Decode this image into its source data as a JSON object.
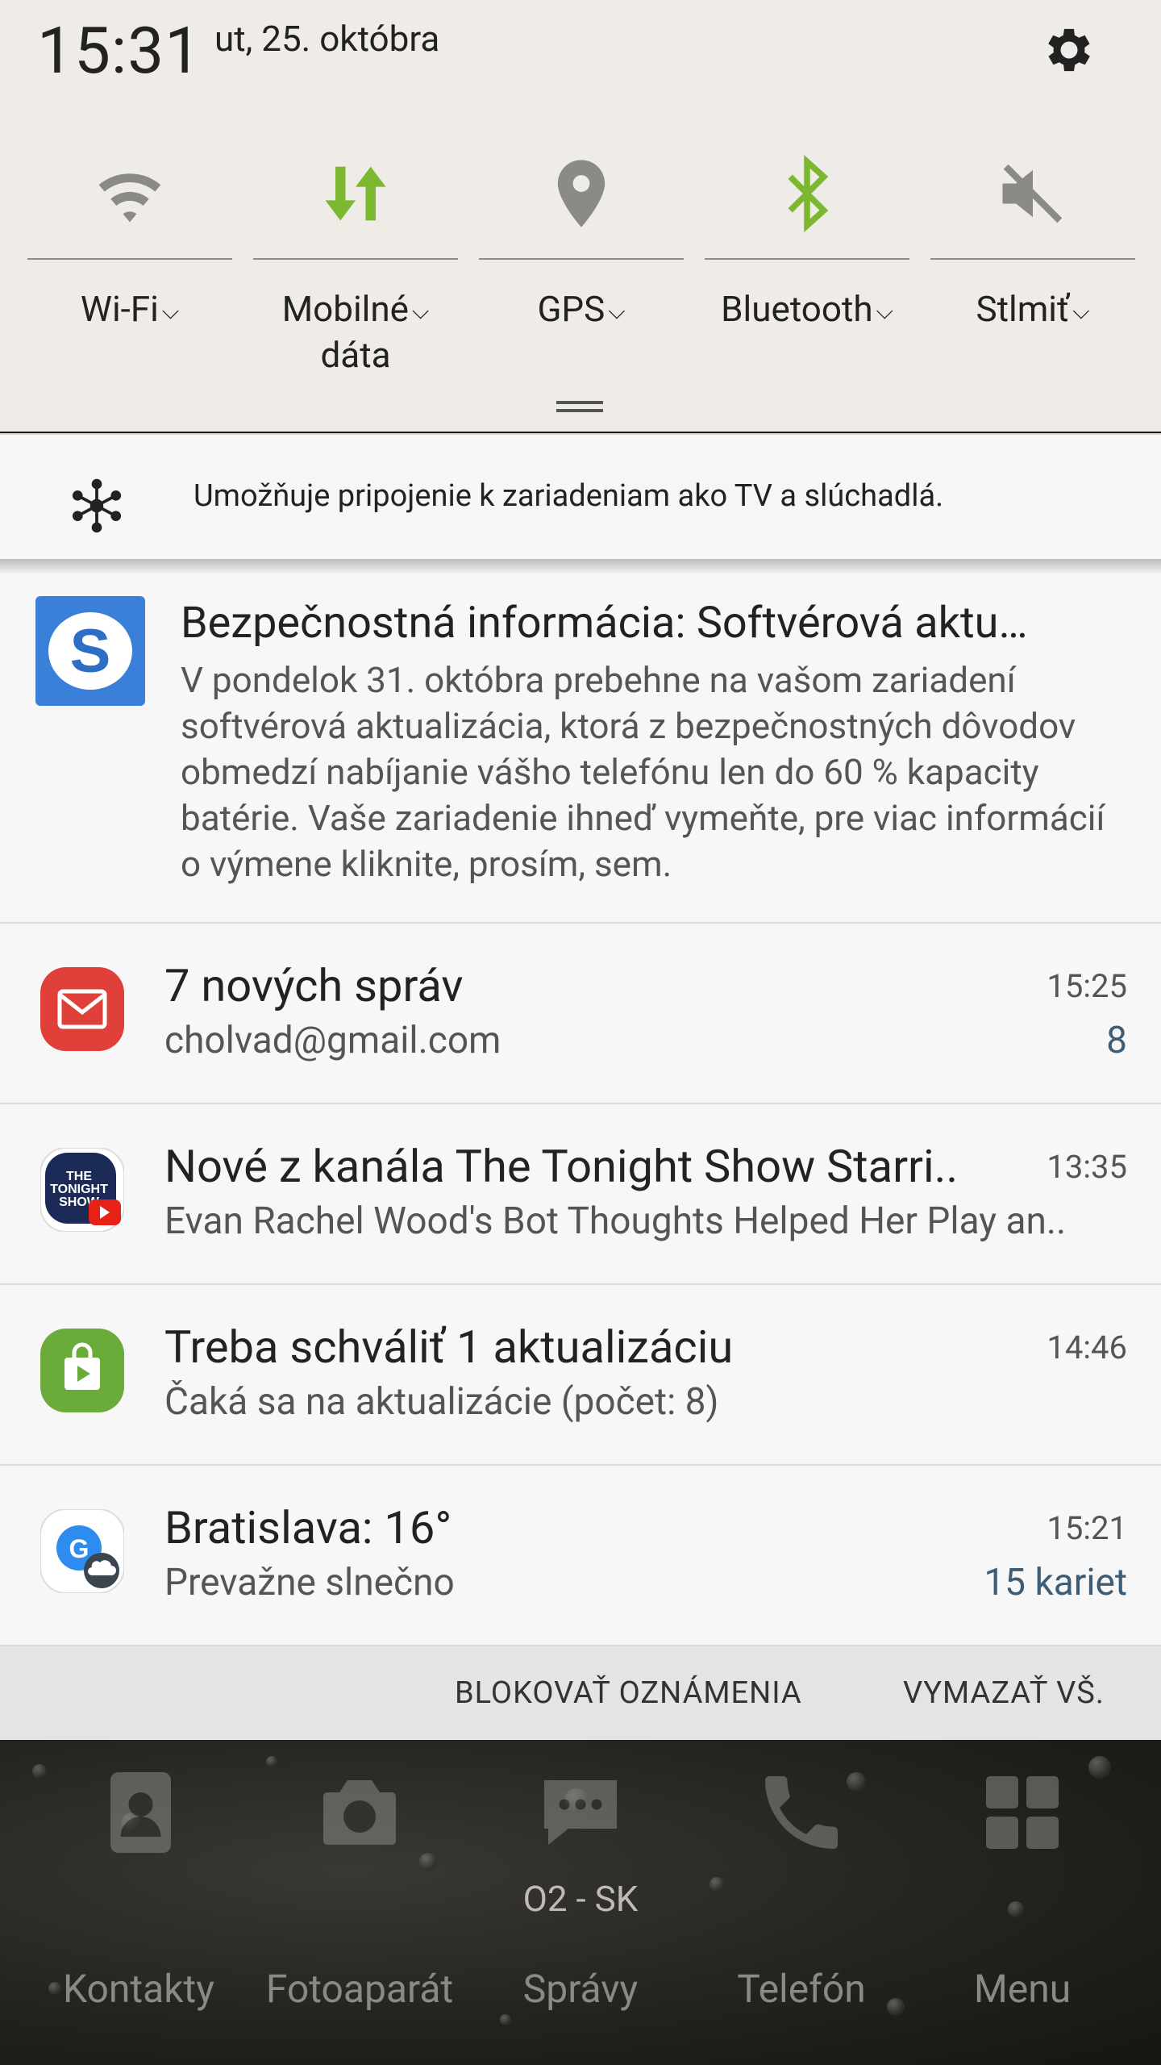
{
  "status": {
    "time": "15:31",
    "date": "ut, 25. októbra"
  },
  "toggles": [
    {
      "label": "Wi-Fi",
      "icon": "wifi-icon",
      "active": false
    },
    {
      "label": "Mobilné",
      "label2": "dáta",
      "icon": "mobile-data-icon",
      "active": true
    },
    {
      "label": "GPS",
      "icon": "location-pin-icon",
      "active": false
    },
    {
      "label": "Bluetooth",
      "icon": "bluetooth-icon",
      "active": true
    },
    {
      "label": "Stlmiť",
      "icon": "mute-icon",
      "active": false
    }
  ],
  "chevron": "⌵",
  "bluetooth_strip": {
    "text": "Umožňuje pripojenie k zariadeniam ako TV a slúchadlá."
  },
  "notifications": [
    {
      "app_icon": "s-app-icon",
      "title": "Bezpečnostná informácia: Softvérová aktu…",
      "body": "V pondelok 31. októbra prebehne na vašom zariadení softvérová aktualizácia, ktorá z bezpečnostných dôvodov obmedzí nabíjanie vášho telefónu len do 60 % kapacity batérie. Vaše zariadenie ihneď vymeňte, pre viac informácií o výmene kliknite, prosím, sem."
    },
    {
      "app_icon": "email-app-icon",
      "title": "7 nových správ",
      "sub": "cholvad@gmail.com",
      "time": "15:25",
      "count": "8"
    },
    {
      "app_icon": "youtube-channel-icon",
      "title": "Nové z kanála The Tonight Show Starri..",
      "sub": "Evan Rachel Wood's Bot Thoughts Helped Her Play an..",
      "time": "13:35"
    },
    {
      "app_icon": "store-app-icon",
      "title": "Treba schváliť 1 aktualizáciu",
      "sub": "Čaká sa na aktualizácie (počet: 8)",
      "time": "14:46"
    },
    {
      "app_icon": "google-weather-icon",
      "title": "Bratislava: 16°",
      "sub": "Prevažne slnečno",
      "time": "15:21",
      "count": "15 kariet"
    }
  ],
  "actions": {
    "block": "BLOKOVAŤ OZNÁMENIA",
    "clear": "VYMAZAŤ VŠ."
  },
  "dock": [
    {
      "label": "Kontakty",
      "icon": "contacts-icon"
    },
    {
      "label": "Fotoaparát",
      "icon": "camera-icon"
    },
    {
      "label": "Správy",
      "icon": "messages-icon"
    },
    {
      "label": "Telefón",
      "icon": "phone-icon"
    },
    {
      "label": "Menu",
      "icon": "apps-grid-icon"
    }
  ],
  "carrier": "O2 - SK",
  "colors": {
    "active_toggle": "#7cb82f",
    "inactive_toggle": "#8a8a86",
    "count_text": "#3e5d74"
  }
}
